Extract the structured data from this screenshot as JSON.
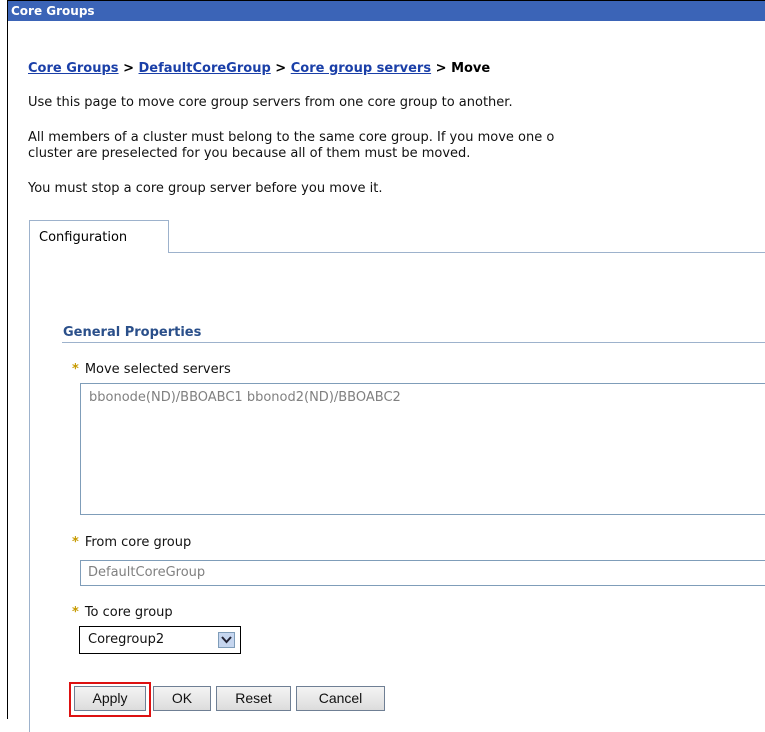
{
  "window": {
    "title": "Core Groups"
  },
  "breadcrumb": {
    "link1": "Core Groups",
    "sep": ">",
    "link2": "DefaultCoreGroup",
    "link3": "Core group servers",
    "current": "Move"
  },
  "intro": {
    "line1": "Use this page to move core group servers from one core group to another.",
    "line2": "All members of a cluster must belong to the same core group. If you move one o",
    "line3": "cluster are preselected for you because all of them must be moved.",
    "line4": "You must stop a core group server before you move it."
  },
  "tabs": [
    {
      "label": "Configuration"
    }
  ],
  "general_properties": {
    "title": "General Properties"
  },
  "fields": {
    "required_marker": "*",
    "move_selected": {
      "label": "Move selected servers",
      "value": "bbonode(ND)/BBOABC1 bbonod2(ND)/BBOABC2"
    },
    "from_core_group": {
      "label": "From core group",
      "value": "DefaultCoreGroup"
    },
    "to_core_group": {
      "label": "To core group",
      "selected": "Coregroup2"
    }
  },
  "buttons": {
    "apply": "Apply",
    "ok": "OK",
    "reset": "Reset",
    "cancel": "Cancel"
  },
  "colors": {
    "titlebar": "#3b64b7",
    "link": "#1a3fa8",
    "highlight": "#dd1111"
  }
}
